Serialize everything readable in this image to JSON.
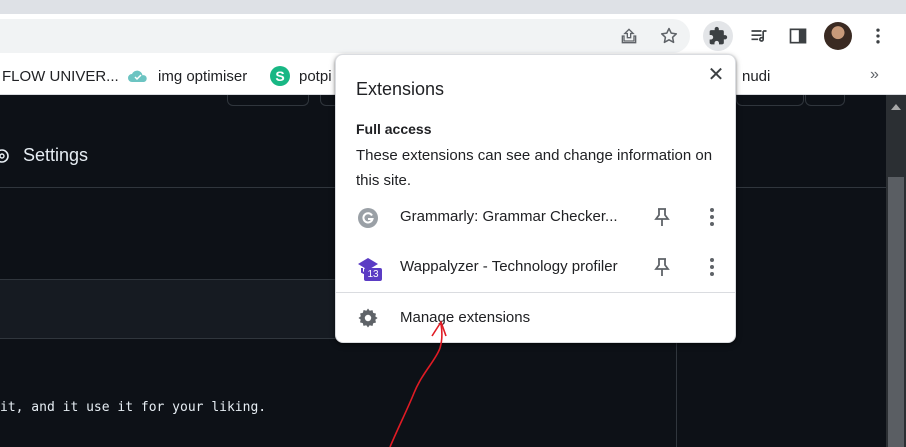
{
  "bookmarks": {
    "items": [
      {
        "label": "FLOW UNIVER..."
      },
      {
        "label": "img optimiser"
      },
      {
        "label": "potpi"
      },
      {
        "label": "nudi"
      }
    ],
    "more_label": "»"
  },
  "page": {
    "settings_label": "Settings",
    "code_line": "it, and it use it for your liking."
  },
  "extensions_popup": {
    "title": "Extensions",
    "close_label": "✕",
    "section_heading": "Full access",
    "section_description": "These extensions can see and change information on this site.",
    "extensions": [
      {
        "name": "Grammarly: Grammar Checker...",
        "icon": "grammarly-icon"
      },
      {
        "name": "Wappalyzer - Technology profiler",
        "icon": "wappalyzer-icon",
        "badge": "13"
      }
    ],
    "manage_label": "Manage extensions"
  },
  "colors": {
    "accent_annotation": "#e01b24",
    "page_background": "#0d1117",
    "wappalyzer_purple": "#5b3cc4",
    "grammarly_gray": "#9aa0a6"
  }
}
